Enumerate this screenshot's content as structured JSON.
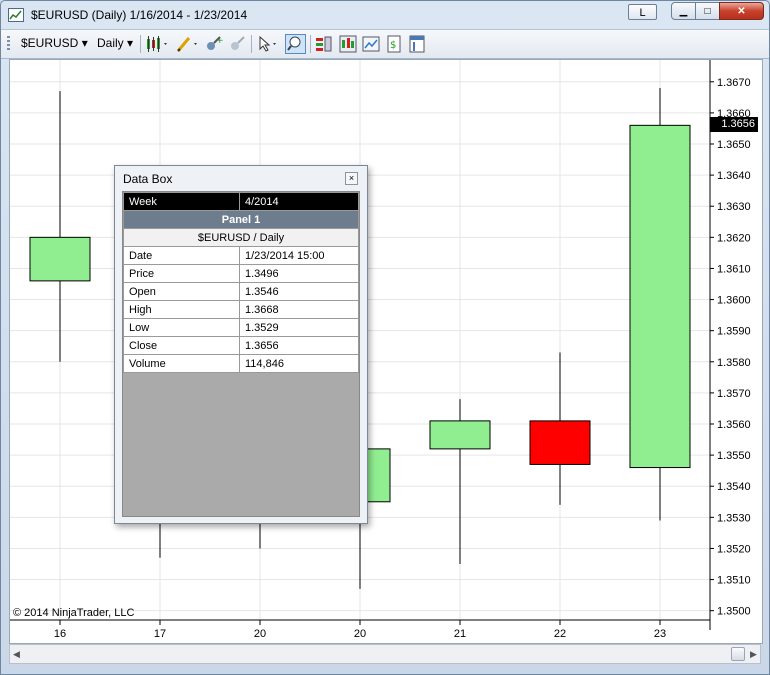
{
  "window": {
    "title": "$EURUSD (Daily)  1/16/2014 - 1/23/2014",
    "l_button": "L",
    "minimize_glyph": "▁",
    "maximize_glyph": "□",
    "close_glyph": "✕"
  },
  "toolbar": {
    "instrument": "$EURUSD",
    "interval": "Daily",
    "dropdown_glyph": "▾",
    "icons": [
      "bar-type-icon",
      "drawing-tools-icon",
      "indicators-icon",
      "strategies-icon",
      "cursor-icon",
      "zoom-icon",
      "data-box-icon",
      "chart-trader-icon",
      "chart-style-icon",
      "export-icon",
      "properties-icon"
    ]
  },
  "chart_data": {
    "type": "candlestick",
    "categories": [
      "16",
      "17",
      "20",
      "20",
      "21",
      "22",
      "23"
    ],
    "candles": [
      {
        "x": "16",
        "open": 1.3606,
        "high": 1.3667,
        "low": 1.358,
        "close": 1.362,
        "color": "#90ee90"
      },
      {
        "x": "17",
        "open": 1.355,
        "high": 1.3575,
        "low": 1.3517,
        "close": 1.354,
        "color": "#90ee90"
      },
      {
        "x": "20",
        "open": 1.3545,
        "high": 1.357,
        "low": 1.352,
        "close": 1.3555,
        "color": "#90ee90"
      },
      {
        "x": "20",
        "open": 1.3535,
        "high": 1.3567,
        "low": 1.3507,
        "close": 1.3552,
        "color": "#90ee90"
      },
      {
        "x": "21",
        "open": 1.3552,
        "high": 1.3568,
        "low": 1.3515,
        "close": 1.3561,
        "color": "#90ee90"
      },
      {
        "x": "22",
        "open": 1.3561,
        "high": 1.3583,
        "low": 1.3534,
        "close": 1.3547,
        "color": "#ff0000"
      },
      {
        "x": "23",
        "open": 1.3546,
        "high": 1.3668,
        "low": 1.3529,
        "close": 1.3656,
        "color": "#90ee90"
      }
    ],
    "y_ticks": [
      "1.3500",
      "1.3510",
      "1.3520",
      "1.3530",
      "1.3540",
      "1.3550",
      "1.3560",
      "1.3570",
      "1.3580",
      "1.3590",
      "1.3600",
      "1.3610",
      "1.3620",
      "1.3630",
      "1.3640",
      "1.3650",
      "1.3660",
      "1.3670"
    ],
    "ylim": [
      1.3497,
      1.3677
    ],
    "last_price": "1.3656",
    "grid": true,
    "copyright": "© 2014 NinjaTrader, LLC"
  },
  "data_box": {
    "title": "Data Box",
    "close_glyph": "×",
    "period_label": "Week",
    "period_value": "4/2014",
    "panel": "Panel 1",
    "instrument_line": "$EURUSD / Daily",
    "rows": [
      {
        "label": "Date",
        "value": "1/23/2014 15:00"
      },
      {
        "label": "Price",
        "value": "1.3496"
      },
      {
        "label": "Open",
        "value": "1.3546"
      },
      {
        "label": "High",
        "value": "1.3668"
      },
      {
        "label": "Low",
        "value": "1.3529"
      },
      {
        "label": "Close",
        "value": "1.3656"
      },
      {
        "label": "Volume",
        "value": "114,846"
      }
    ]
  },
  "scrollbar": {
    "left_arrow": "◀",
    "right_arrow": "▶"
  }
}
